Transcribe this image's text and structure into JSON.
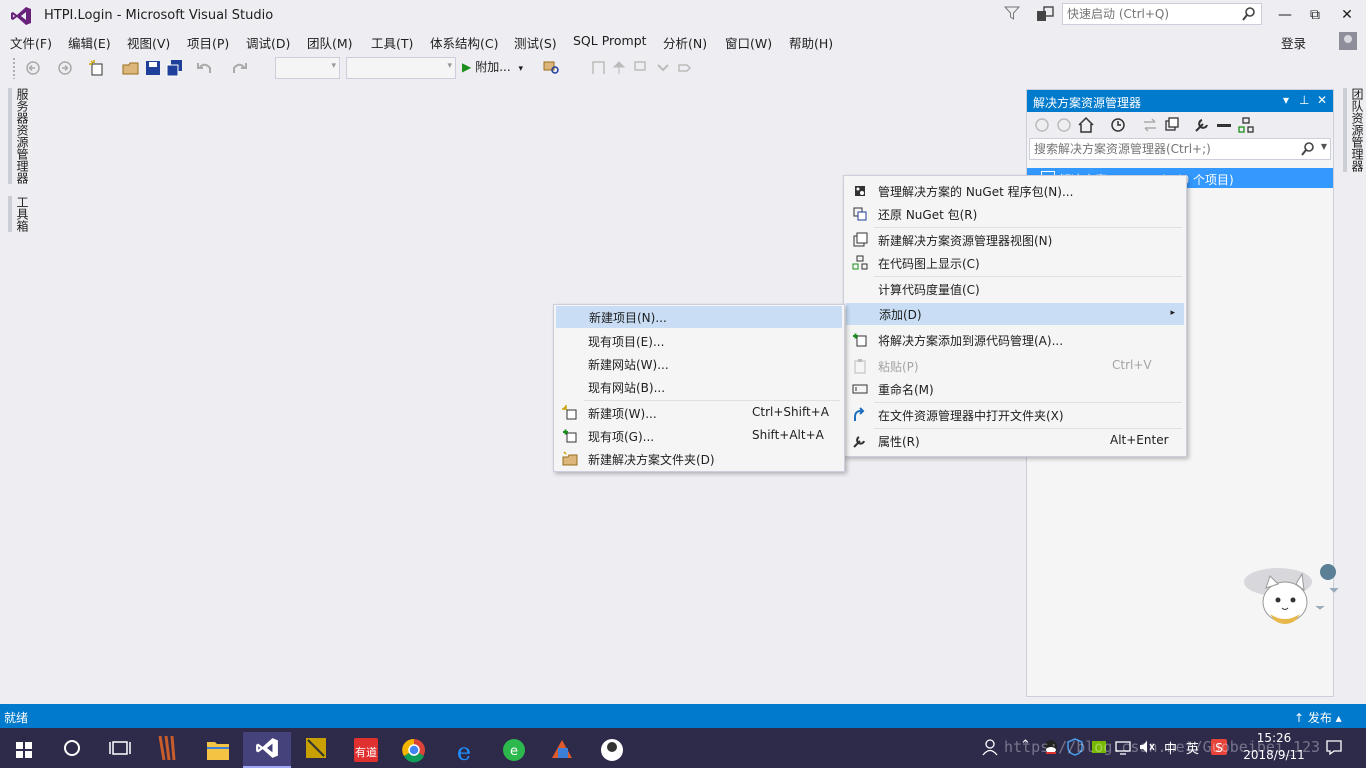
{
  "window": {
    "title": "HTPI.Login - Microsoft Visual Studio",
    "quicklaunch_placeholder": "快速启动 (Ctrl+Q)",
    "login_label": "登录",
    "minimize": "—",
    "maximize": "⧉",
    "close": "✕"
  },
  "menubar": {
    "items": [
      "文件(F)",
      "编辑(E)",
      "视图(V)",
      "项目(P)",
      "调试(D)",
      "团队(M)",
      "工具(T)",
      "体系结构(C)",
      "测试(S)",
      "SQL Prompt",
      "分析(N)",
      "窗口(W)",
      "帮助(H)"
    ]
  },
  "toolbar": {
    "attach_label": "附加...",
    "attach_dropdown": "▾"
  },
  "left_tabs": {
    "server_explorer": "服务器资源管理器",
    "toolbox": "工具箱"
  },
  "right_tabs": {
    "team_explorer": "团队资源管理器"
  },
  "solution_explorer": {
    "title": "解决方案资源管理器",
    "header_buttons": [
      "▾",
      "⊥",
      "✕"
    ],
    "search_placeholder": "搜索解决方案资源管理器(Ctrl+;)",
    "root_item": "解决方案'HTPI.Login'(0 个项目)"
  },
  "context_menu": {
    "items": [
      {
        "label": "管理解决方案的 NuGet 程序包(N)...",
        "shortcut": "",
        "icon": "nuget-icon"
      },
      {
        "label": "还原 NuGet 包(R)",
        "shortcut": "",
        "icon": "restore-icon"
      },
      {
        "label": "新建解决方案资源管理器视图(N)",
        "shortcut": "",
        "icon": "new-view-icon"
      },
      {
        "label": "在代码图上显示(C)",
        "shortcut": "",
        "icon": "code-map-icon"
      },
      {
        "label": "计算代码度量值(C)",
        "shortcut": "",
        "icon": ""
      },
      {
        "label": "添加(D)",
        "shortcut": "",
        "icon": ""
      },
      {
        "label": "将解决方案添加到源代码管理(A)...",
        "shortcut": "",
        "icon": "source-control-icon"
      },
      {
        "label": "粘贴(P)",
        "shortcut": "Ctrl+V",
        "icon": "paste-icon"
      },
      {
        "label": "重命名(M)",
        "shortcut": "",
        "icon": "rename-icon"
      },
      {
        "label": "在文件资源管理器中打开文件夹(X)",
        "shortcut": "",
        "icon": "open-folder-icon"
      },
      {
        "label": "属性(R)",
        "shortcut": "Alt+Enter",
        "icon": "properties-icon"
      }
    ],
    "submenu_arrow": "▸"
  },
  "add_submenu": {
    "items": [
      {
        "label": "新建项目(N)...",
        "shortcut": ""
      },
      {
        "label": "现有项目(E)...",
        "shortcut": ""
      },
      {
        "label": "新建网站(W)...",
        "shortcut": ""
      },
      {
        "label": "现有网站(B)...",
        "shortcut": ""
      },
      {
        "label": "新建项(W)...",
        "shortcut": "Ctrl+Shift+A"
      },
      {
        "label": "现有项(G)...",
        "shortcut": "Shift+Alt+A"
      },
      {
        "label": "新建解决方案文件夹(D)",
        "shortcut": ""
      }
    ]
  },
  "statusbar": {
    "status": "就绪",
    "publish": "↑ 发布 ▴"
  },
  "taskbar": {
    "tray_ime": "英",
    "tray_text": "中",
    "time": "15:26",
    "date": "2018/9/11",
    "watermark": "https://blog.csdn.net/Guobeibei_123"
  },
  "colors": {
    "accent": "#007acc",
    "selection": "#3399ff",
    "menu_highlight": "#c9def5",
    "vs_purple": "#68217a",
    "taskbar": "#2d2a4a"
  }
}
